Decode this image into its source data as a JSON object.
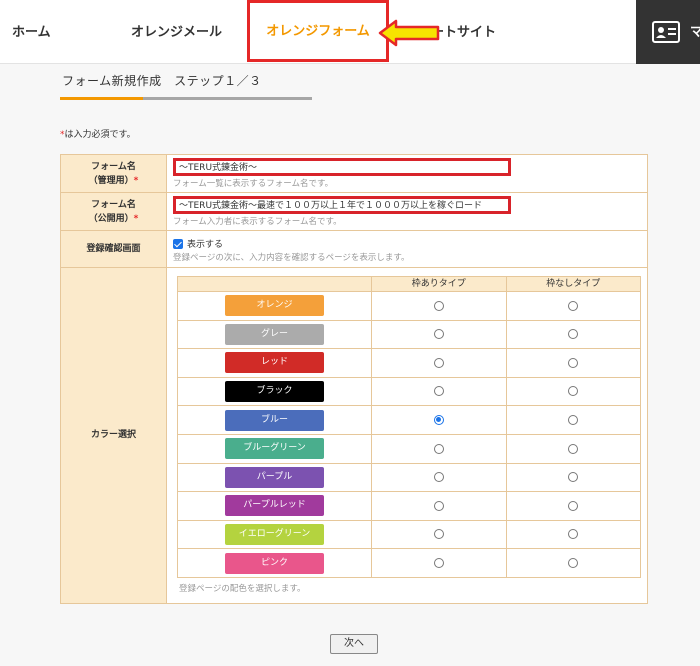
{
  "nav": {
    "home": "ホーム",
    "mail": "オレンジメール",
    "form": "オレンジフォーム",
    "support": "ートサイト",
    "user_initial": "マ",
    "user_icon": "id-card-icon",
    "arrow_icon": "arrow-left-icon"
  },
  "step": {
    "label": "フォーム新規作成　ステップ１／３",
    "progress": 0.33
  },
  "required_note": {
    "mark": "*",
    "text": "は入力必須です。"
  },
  "fields": {
    "admin_name": {
      "label1": "フォーム名",
      "label2": "（管理用）",
      "req": "*",
      "value": "〜TERU式錬金術〜",
      "hint": "フォーム一覧に表示するフォーム名です。"
    },
    "public_name": {
      "label1": "フォーム名",
      "label2": "（公開用）",
      "req": "*",
      "value": "〜TERU式錬金術〜最速で１００万以上１年で１０００万以上を稼ぐロード",
      "hint": "フォーム入力者に表示するフォーム名です。"
    },
    "confirm": {
      "label": "登録確認画面",
      "checkbox_label": "表示する",
      "checked": true,
      "hint": "登録ページの次に、入力内容を確認するページを表示します。"
    },
    "color": {
      "label": "カラー選択",
      "col_framed": "枠ありタイプ",
      "col_frameless": "枠なしタイプ",
      "hint": "登録ページの配色を選択します。",
      "options": [
        {
          "name": "オレンジ",
          "color": "#f4a03a",
          "selected": ""
        },
        {
          "name": "グレー",
          "color": "#ababab",
          "selected": ""
        },
        {
          "name": "レッド",
          "color": "#d12b27",
          "selected": ""
        },
        {
          "name": "ブラック",
          "color": "#000000",
          "selected": ""
        },
        {
          "name": "ブルー",
          "color": "#4b6dbb",
          "selected": "framed"
        },
        {
          "name": "ブルーグリーン",
          "color": "#4aae8d",
          "selected": ""
        },
        {
          "name": "パープル",
          "color": "#7c52b0",
          "selected": ""
        },
        {
          "name": "パープルレッド",
          "color": "#a13a9d",
          "selected": ""
        },
        {
          "name": "イエローグリーン",
          "color": "#b4d33f",
          "selected": ""
        },
        {
          "name": "ピンク",
          "color": "#e9568b",
          "selected": ""
        }
      ]
    }
  },
  "next_button": "次へ"
}
